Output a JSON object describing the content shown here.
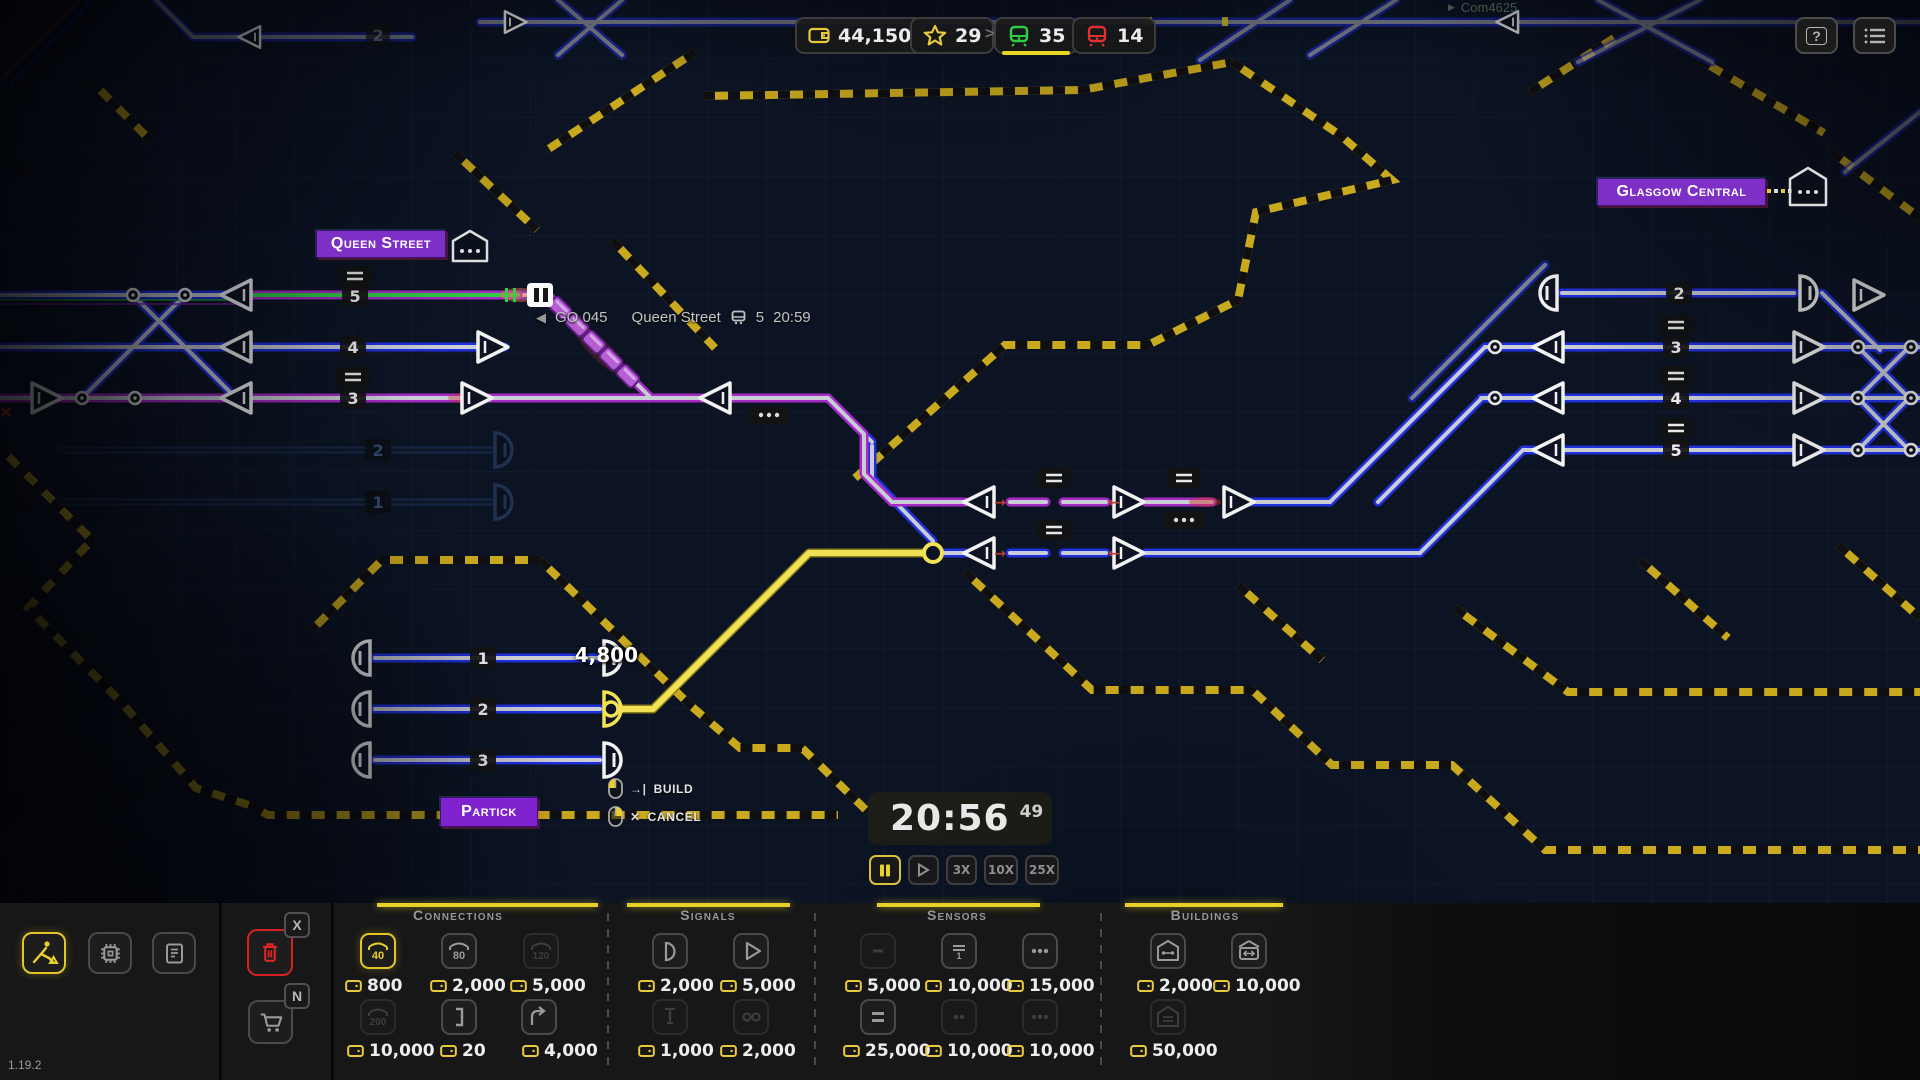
{
  "hud": {
    "money": "44,150",
    "stars": "29",
    "trains_green": "35",
    "trains_red": "14",
    "badge_separator": ">",
    "session": "Com4625",
    "help_label": "?",
    "version": "1.19.2"
  },
  "map": {
    "stations": {
      "queen_street": "Queen Street",
      "glasgow_central": "Glasgow Central",
      "partick": "Partick"
    },
    "train_info": {
      "id": "GO 045",
      "station": "Queen Street",
      "platform": "5",
      "time": "20:59"
    },
    "build_cost": "4,800",
    "build_key": "→|",
    "build_tooltip": "BUILD",
    "cancel_key": "✕",
    "cancel_tooltip": "CANCEL",
    "platforms": {
      "top": [
        "2"
      ],
      "queen_street": [
        "5",
        "4",
        "3"
      ],
      "queen_street_ghost": [
        "2",
        "1"
      ],
      "glasgow_central": [
        "2",
        "3",
        "4",
        "5"
      ],
      "partick": [
        "1",
        "2",
        "3"
      ]
    }
  },
  "clock": {
    "time": "20:56",
    "seconds": "49"
  },
  "speed": {
    "x3": "3X",
    "x10": "10X",
    "x25": "25X"
  },
  "toolbar": {
    "hotkey_delete": "X",
    "hotkey_buy": "N",
    "sections": [
      {
        "title": "Connections",
        "items": [
          {
            "label": "40",
            "price": "800"
          },
          {
            "label": "80",
            "price": "2,000"
          },
          {
            "label": "120",
            "price": "5,000"
          },
          {
            "label": "200",
            "price": "10,000"
          },
          {
            "label": "",
            "price": "20"
          },
          {
            "label": "",
            "price": "4,000"
          }
        ]
      },
      {
        "title": "Signals",
        "items": [
          {
            "price": "2,000"
          },
          {
            "price": "5,000"
          },
          {
            "price": "1,000"
          },
          {
            "price": "2,000"
          }
        ]
      },
      {
        "title": "Sensors",
        "items": [
          {
            "price": "5,000"
          },
          {
            "price": "10,000"
          },
          {
            "price": "15,000"
          },
          {
            "price": "25,000"
          },
          {
            "price": "10,000"
          },
          {
            "price": "10,000"
          }
        ]
      },
      {
        "title": "Buildings",
        "items": [
          {
            "price": "2,000"
          },
          {
            "price": "10,000"
          },
          {
            "price": "50,000"
          }
        ]
      }
    ]
  }
}
